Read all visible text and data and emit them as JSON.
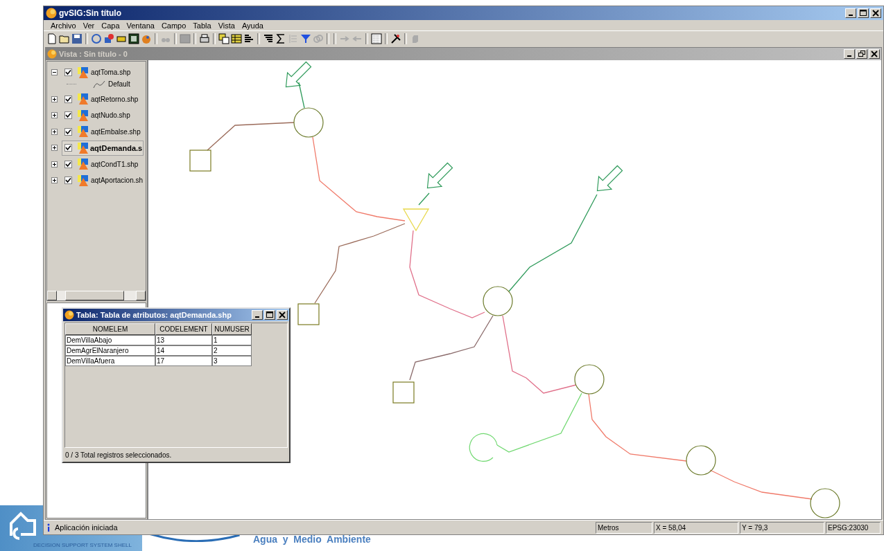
{
  "background": {
    "tagline": "DECISION SUPPORT SYSTEM SHELL",
    "caption": "Agua  y  Medio  Ambiente"
  },
  "window": {
    "title": "gvSIG:Sin título"
  },
  "menu": [
    "Archivo",
    "Ver",
    "Capa",
    "Ventana",
    "Campo",
    "Tabla",
    "Vista",
    "Ayuda"
  ],
  "view_window": {
    "title": "Vista : Sin título - 0"
  },
  "layers": [
    {
      "label": "aqtToma.shp",
      "checked": true,
      "expanded": true,
      "selected": false,
      "children": [
        {
          "label": "Default"
        }
      ]
    },
    {
      "label": "aqtRetorno.shp",
      "checked": true,
      "expanded": false,
      "selected": false
    },
    {
      "label": "aqtNudo.shp",
      "checked": true,
      "expanded": false,
      "selected": false
    },
    {
      "label": "aqtEmbalse.shp",
      "checked": true,
      "expanded": false,
      "selected": false
    },
    {
      "label": "aqtDemanda.s",
      "checked": true,
      "expanded": false,
      "selected": true
    },
    {
      "label": "aqtCondT1.shp",
      "checked": true,
      "expanded": false,
      "selected": false
    },
    {
      "label": "aqtAportacion.sh",
      "checked": true,
      "expanded": false,
      "selected": false
    }
  ],
  "table_window": {
    "title": "Tabla: Tabla de atributos: aqtDemanda.shp",
    "columns": [
      "NOMELEM",
      "CODELEMENT",
      "NUMUSER"
    ],
    "rows": [
      [
        "DemVillaAbajo",
        "13",
        "1"
      ],
      [
        "DemAgrElNaranjero",
        "14",
        "2"
      ],
      [
        "DemVillaAfuera",
        "17",
        "3"
      ]
    ],
    "footer": "0 / 3 Total registros seleccionados."
  },
  "status_bar": {
    "message": "Aplicación iniciada",
    "units": "Metros",
    "x": "X = 58,04",
    "y": "Y = 79,3",
    "crs": "EPSG:23030"
  }
}
